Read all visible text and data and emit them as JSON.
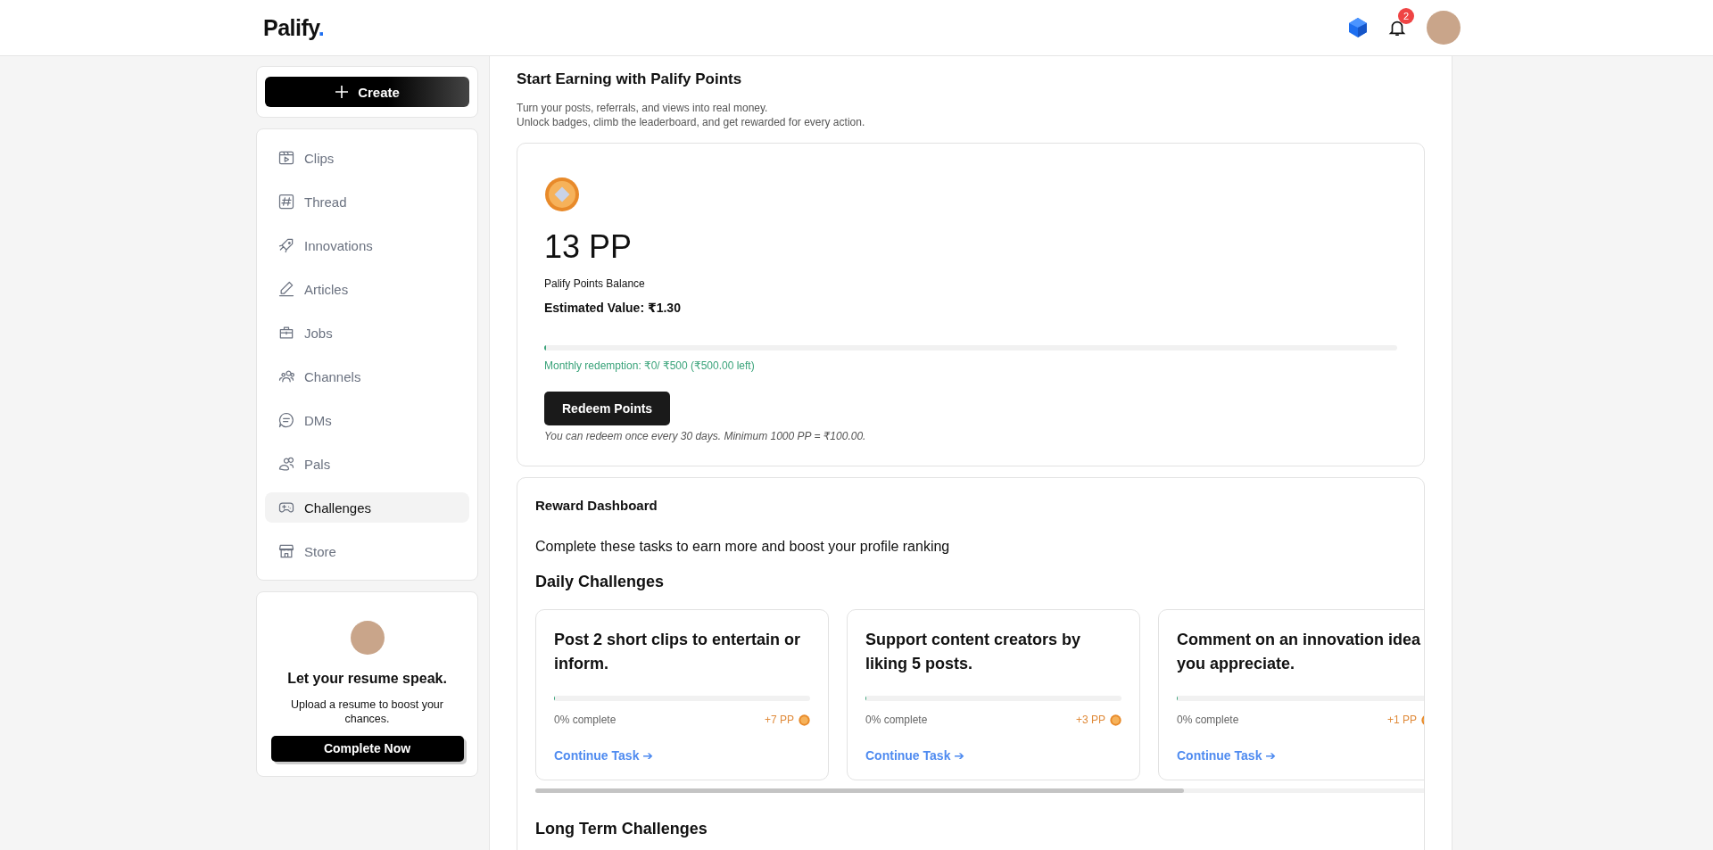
{
  "header": {
    "logo": "Palify",
    "logo_dot": ".",
    "notifications": {
      "count": "2"
    }
  },
  "create_button": {
    "label": "Create"
  },
  "sidebar": {
    "items": [
      {
        "label": "Clips",
        "selected": false
      },
      {
        "label": "Thread",
        "selected": false
      },
      {
        "label": "Innovations",
        "selected": false
      },
      {
        "label": "Articles",
        "selected": false
      },
      {
        "label": "Jobs",
        "selected": false
      },
      {
        "label": "Channels",
        "selected": false
      },
      {
        "label": "DMs",
        "selected": false
      },
      {
        "label": "Pals",
        "selected": false
      },
      {
        "label": "Challenges",
        "selected": true
      },
      {
        "label": "Store",
        "selected": false
      }
    ]
  },
  "resume_card": {
    "title": "Let your resume speak.",
    "text": "Upload a resume to boost your chances.",
    "button": "Complete Now"
  },
  "main": {
    "title": "Start Earning with Palify Points",
    "subtitle_lines": [
      "Turn your posts, referrals, and views into real money.",
      "Unlock badges, climb the leaderboard, and get rewarded for every action."
    ]
  },
  "balance": {
    "amount": "13 PP",
    "label": "Palify Points Balance",
    "estimated": "Estimated Value: ₹1.30",
    "redemption": {
      "level": 0.002,
      "text": "Monthly redemption: ₹0/ ₹500 (₹500.00 left)"
    },
    "button": "Redeem Points",
    "note": "You can redeem once every 30 days. Minimum 1000 PP = ₹100.00."
  },
  "rewards": {
    "title": "Reward Dashboard",
    "intro": "Complete these tasks to earn more and boost your profile ranking",
    "daily_title": "Daily Challenges",
    "tasks": [
      {
        "title": "Post 2 short clips to entertain or inform.",
        "level": 0,
        "progress": "0% complete",
        "points": "+7 PP",
        "link": "Continue Task ➔"
      },
      {
        "title": "Support content creators by liking 5 posts.",
        "level": 0.003,
        "progress": "0% complete",
        "points": "+3 PP",
        "link": "Continue Task ➔"
      },
      {
        "title": "Comment on an innovation idea you appreciate.",
        "level": 0,
        "progress": "0% complete",
        "points": "+1 PP",
        "link": "Continue Task ➔"
      }
    ],
    "long_term_title": "Long Term Challenges"
  }
}
